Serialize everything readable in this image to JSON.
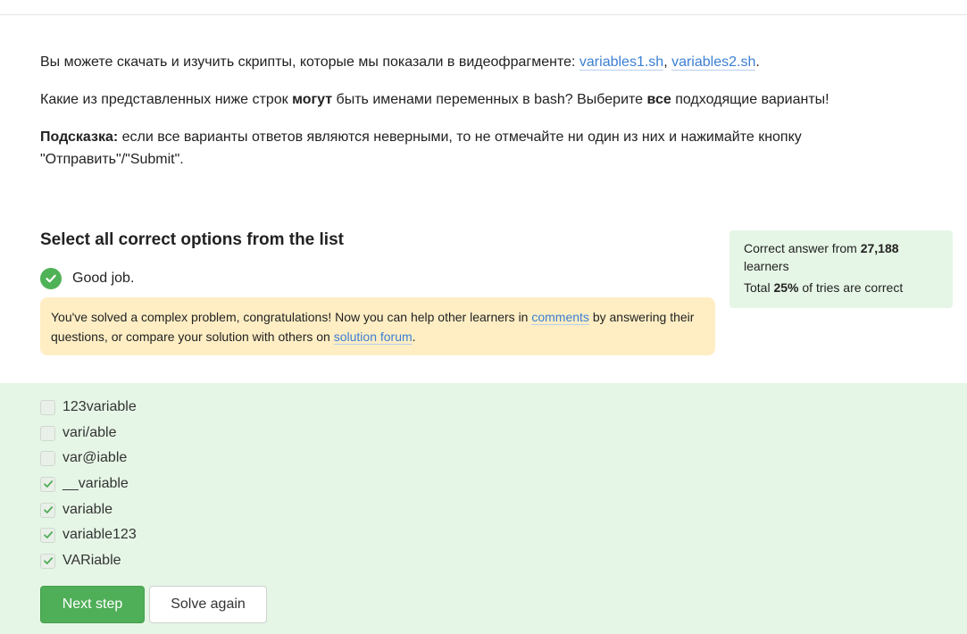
{
  "intro": {
    "p1_text": "Вы можете скачать и изучить скрипты, которые мы показали в видеофрагменте: ",
    "p1_link1": "variables1.sh",
    "p1_sep": ", ",
    "p1_link2": "variables2.sh",
    "p1_end": ".",
    "p2_a": "Какие из представленных ниже строк ",
    "p2_bold1": "могут",
    "p2_b": " быть именами переменных в bash? Выберите ",
    "p2_bold2": "все",
    "p2_c": " подходящие варианты!",
    "p3_bold": "Подсказка:",
    "p3_text": " если все варианты ответов являются неверными, то не отмечайте ни один из них и нажимайте кнопку \"Отправить\"/\"Submit\"."
  },
  "question": {
    "title": "Select all correct options from the list",
    "status_text": "Good job.",
    "note_a": "You've solved a complex problem, congratulations! Now you can help other learners in ",
    "note_link1": "comments",
    "note_b": " by answering their questions, or compare your solution with others on ",
    "note_link2": "solution forum",
    "note_c": "."
  },
  "stats": {
    "a": "Correct answer from ",
    "learners_count": "27,188",
    "b": " learners",
    "c": "Total ",
    "percent": "25%",
    "d": " of tries are correct"
  },
  "options": [
    {
      "label": "123variable",
      "checked": false
    },
    {
      "label": "vari/able",
      "checked": false
    },
    {
      "label": "var@iable",
      "checked": false
    },
    {
      "label": "__variable",
      "checked": true
    },
    {
      "label": "variable",
      "checked": true
    },
    {
      "label": "variable123",
      "checked": true
    },
    {
      "label": "VARiable",
      "checked": true
    }
  ],
  "buttons": {
    "next": "Next step",
    "again": "Solve again"
  },
  "colors": {
    "accent_green": "#4fae58",
    "link_blue": "#3b7fd4",
    "note_bg": "#ffeec4",
    "answers_bg": "#e6f6e6"
  }
}
